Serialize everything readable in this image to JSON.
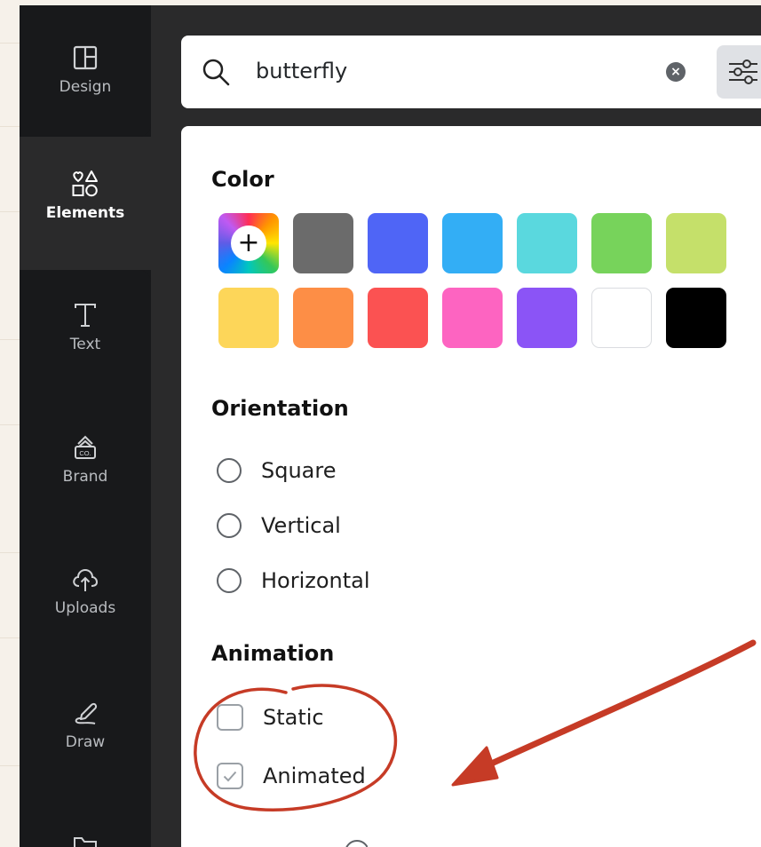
{
  "sidebar": {
    "items": [
      {
        "label": "Design",
        "icon": "layout-icon"
      },
      {
        "label": "Elements",
        "icon": "shapes-icon"
      },
      {
        "label": "Text",
        "icon": "text-t-icon"
      },
      {
        "label": "Brand",
        "icon": "brand-kit-icon"
      },
      {
        "label": "Uploads",
        "icon": "cloud-upload-icon"
      },
      {
        "label": "Draw",
        "icon": "pen-icon"
      }
    ]
  },
  "search": {
    "value": "butterfly"
  },
  "filters": {
    "color_heading": "Color",
    "colors": [
      "#6b6b6b",
      "#4f65f6",
      "#33aef5",
      "#5ad8de",
      "#77d35b",
      "#c5e06a",
      "#fdd659",
      "#fd8e46",
      "#fb5252",
      "#fd64c1",
      "#8b54f6",
      "#ffffff",
      "#000000"
    ],
    "orientation_heading": "Orientation",
    "orientation_options": [
      "Square",
      "Vertical",
      "Horizontal"
    ],
    "animation_heading": "Animation",
    "animation_options": [
      {
        "label": "Static",
        "checked": false
      },
      {
        "label": "Animated",
        "checked": true
      }
    ]
  },
  "annotation": {
    "color": "#c63b26"
  }
}
